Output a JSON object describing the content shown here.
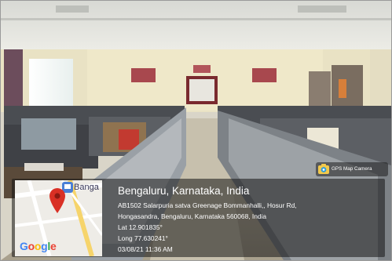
{
  "geotag": {
    "city_line": "Bengaluru, Karnataka, India",
    "address_line1": "AB1502 Salarpuria satva Greenage Bommanhalli,, Hosur Rd,",
    "address_line2": "Hongasandra, Bengaluru, Karnataka 560068, India",
    "latitude": "Lat 12.901835°",
    "longitude": "Long 77.630241°",
    "datetime": "03/08/21 11:36 AM"
  },
  "map": {
    "place_label": "Banga",
    "attribution": "Google",
    "pin_color": "#d93025"
  },
  "app_badge": {
    "label": "GPS Map Camera",
    "icon": "gps-camera-icon"
  }
}
